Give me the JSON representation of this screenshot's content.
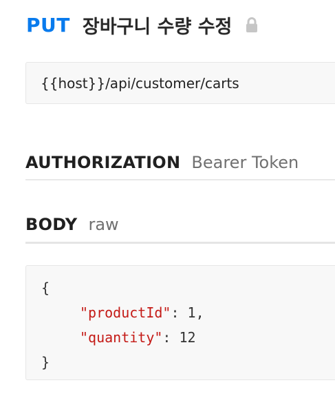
{
  "request": {
    "method": "PUT",
    "name": "장바구니 수량 수정",
    "lock_icon": "lock-icon",
    "method_color": "#097bed"
  },
  "url": "{{host}}/api/customer/carts",
  "authorization": {
    "title": "AUTHORIZATION",
    "value": "Bearer Token"
  },
  "body": {
    "title": "BODY",
    "mode": "raw",
    "code": {
      "open_brace": "{",
      "lines": [
        {
          "key": "\"productId\"",
          "sep": ": ",
          "value": "1",
          "trail": ","
        },
        {
          "key": "\"quantity\"",
          "sep": ": ",
          "value": "12",
          "trail": ""
        }
      ],
      "close_brace": "}"
    }
  }
}
